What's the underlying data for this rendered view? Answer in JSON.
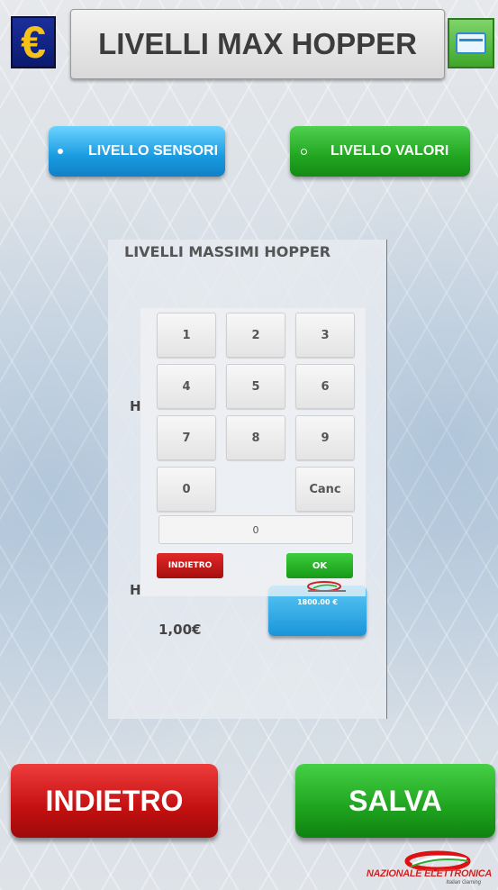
{
  "header": {
    "title": "LIVELLI MAX HOPPER",
    "euro_symbol": "€",
    "left_icon": "euro-icon",
    "right_icon": "card-icon"
  },
  "tabs": [
    {
      "label": "LIVELLO SENSORI",
      "selected": true,
      "color": "#1a9be0"
    },
    {
      "label": "LIVELLO VALORI",
      "selected": false,
      "color": "#22a622"
    }
  ],
  "panel": {
    "title": "LIVELLI MASSIMI HOPPER",
    "row_labels": [
      "H",
      "H"
    ],
    "current_value": "1,00€",
    "value_button": "1800.00 €"
  },
  "keypad": {
    "keys": [
      "1",
      "2",
      "3",
      "4",
      "5",
      "6",
      "7",
      "8",
      "9",
      "0",
      "Canc"
    ],
    "display": "0",
    "back_label": "INDIETRO",
    "ok_label": "OK"
  },
  "footer": {
    "back_label": "INDIETRO",
    "save_label": "SALVA",
    "logo_text": "NAZIONALE ELETTRONICA",
    "logo_subtext": "Italian Gaming",
    "back_color": "#c41010",
    "save_color": "#1fa31f"
  }
}
